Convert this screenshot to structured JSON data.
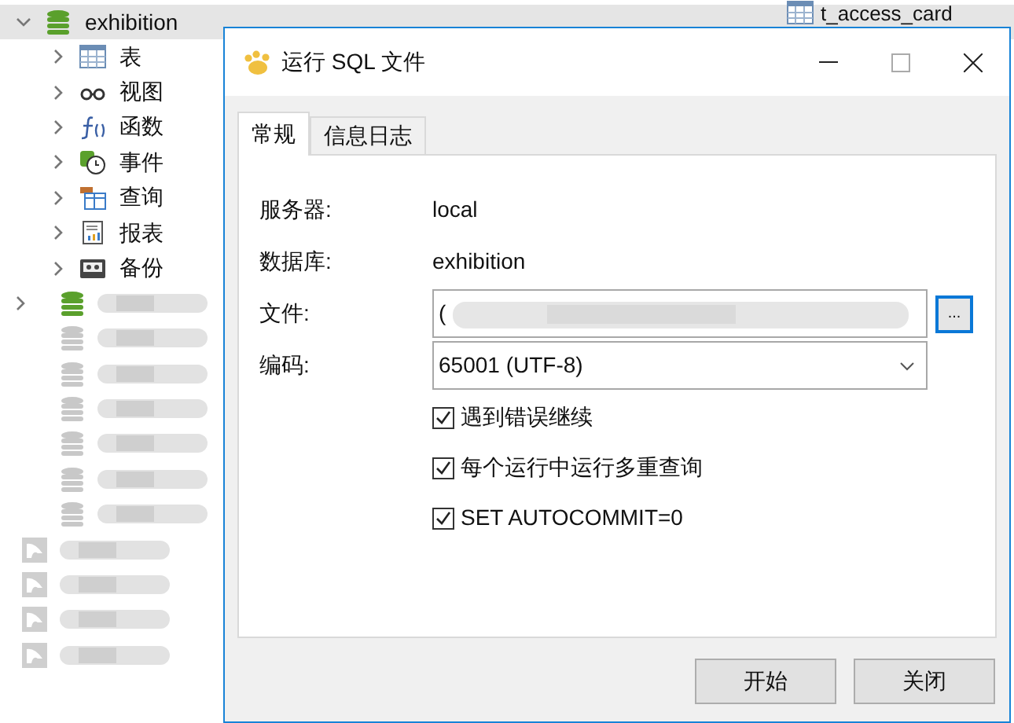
{
  "tree": {
    "database": "exhibition",
    "expanded": true,
    "selected": true,
    "children": [
      {
        "kind": "table",
        "label": "表"
      },
      {
        "kind": "view",
        "label": "视图"
      },
      {
        "kind": "function",
        "label": "函数"
      },
      {
        "kind": "event",
        "label": "事件"
      },
      {
        "kind": "query",
        "label": "查询"
      },
      {
        "kind": "report",
        "label": "报表"
      },
      {
        "kind": "backup",
        "label": "备份"
      }
    ],
    "hidden_items": [
      {
        "kind": "database",
        "open": true
      },
      {
        "kind": "database",
        "open": false
      },
      {
        "kind": "database",
        "open": false
      },
      {
        "kind": "database",
        "open": false
      },
      {
        "kind": "database",
        "open": false
      },
      {
        "kind": "database",
        "open": false
      },
      {
        "kind": "database",
        "open": false
      },
      {
        "kind": "connection",
        "open": false
      },
      {
        "kind": "connection",
        "open": false
      },
      {
        "kind": "connection",
        "open": false
      },
      {
        "kind": "connection",
        "open": false
      }
    ]
  },
  "background_item": "t_access_card",
  "dialog": {
    "title": "运行 SQL 文件",
    "tabs": [
      {
        "label": "常规",
        "selected": true
      },
      {
        "label": "信息日志",
        "selected": false
      }
    ],
    "fields": [
      {
        "kind": "text",
        "label": "服务器:",
        "value": "local"
      },
      {
        "kind": "text",
        "label": "数据库:",
        "value": "exhibition"
      },
      {
        "kind": "file",
        "label": "文件:",
        "value": "(",
        "browse": "..."
      },
      {
        "kind": "select",
        "label": "编码:",
        "value": "65001 (UTF-8)"
      }
    ],
    "options": [
      {
        "label": "遇到错误继续",
        "checked": true
      },
      {
        "label": "每个运行中运行多重查询",
        "checked": true
      },
      {
        "label": "SET AUTOCOMMIT=0",
        "checked": true
      }
    ],
    "buttons": [
      "开始",
      "关闭"
    ]
  }
}
